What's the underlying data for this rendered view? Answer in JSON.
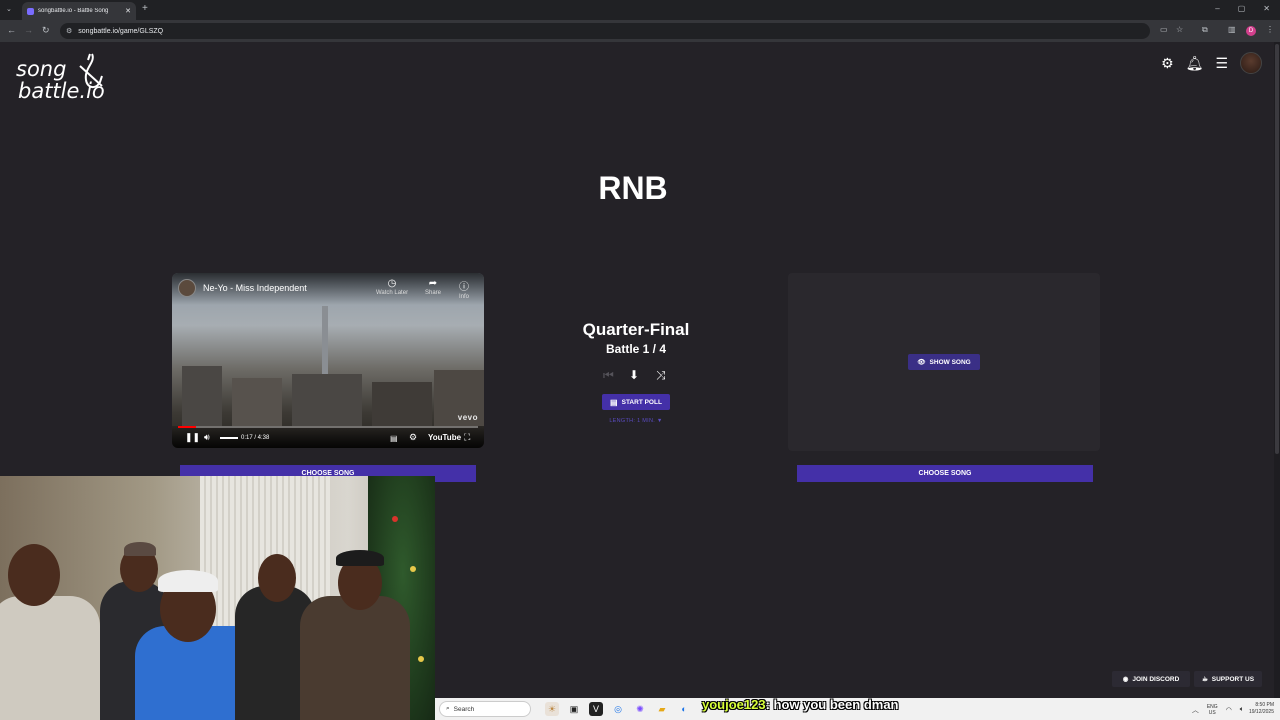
{
  "browser": {
    "tab_title": "songbattle.io - Battle Song",
    "url": "songbattle.io/game/GLSZQ",
    "profile_initial": "D",
    "icons": [
      "tab-dropdown-icon",
      "close-tab-icon",
      "new-tab-icon",
      "back-icon",
      "forward-icon",
      "reload-icon",
      "tune-icon",
      "bookmark-star-icon",
      "extensions-icon"
    ]
  },
  "site": {
    "logo_line1": "song",
    "logo_line2": "battle.io",
    "header_icons": [
      "settings-gear-icon",
      "notification-bell-icon",
      "menu-hamburger-icon"
    ]
  },
  "game": {
    "genre": "RNB",
    "round": "Quarter-Final",
    "battle": "Battle 1 / 4",
    "start_poll": "START POLL",
    "length": "LENGTH: 1 MIN. ▼",
    "show_song": "SHOW SONG",
    "choose_song_left": "CHOOSE SONG",
    "choose_song_right": "CHOOSE SONG"
  },
  "video": {
    "title": "Ne-Yo - Miss Independent",
    "watch_later": "Watch Later",
    "share": "Share",
    "info": "Info",
    "time": "0:17 / 4:38",
    "brand": "vevo",
    "platform": "YouTube",
    "progress_fraction": 0.061
  },
  "footer": {
    "join_discord": "JOIN DISCORD",
    "support_us": "SUPPORT US"
  },
  "taskbar": {
    "search_placeholder": "Search",
    "chat_user": "youjoe123",
    "chat_message": ": how you been dman",
    "lang_line1": "ENG",
    "lang_line2": "US",
    "time": "8:50 PM",
    "date": "19/12/2025"
  },
  "colors": {
    "page_bg": "#242227",
    "accent_purple": "#4430a8",
    "panel_bg": "#2a282d"
  }
}
